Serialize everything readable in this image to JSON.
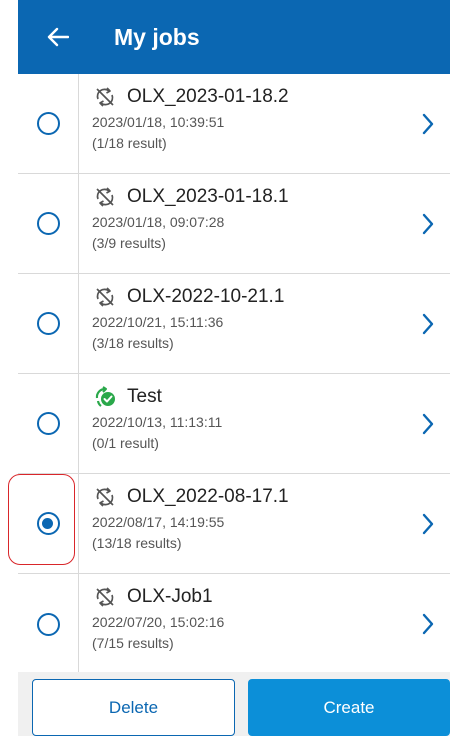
{
  "header": {
    "title": "My jobs",
    "back_icon": "arrow-left-icon",
    "color": "#0b67b2"
  },
  "jobs": [
    {
      "name": "OLX_2023-01-18.2",
      "date": "2023/01/18, 10:39:51",
      "results": "(1/18 result)",
      "icon": "sync-disabled-icon",
      "selected": false
    },
    {
      "name": "OLX_2023-01-18.1",
      "date": "2023/01/18, 09:07:28",
      "results": "(3/9 results)",
      "icon": "sync-disabled-icon",
      "selected": false
    },
    {
      "name": "OLX-2022-10-21.1",
      "date": "2022/10/21, 15:11:36",
      "results": "(3/18 results)",
      "icon": "sync-disabled-icon",
      "selected": false
    },
    {
      "name": "Test",
      "date": "2022/10/13, 11:13:11",
      "results": "(0/1 result)",
      "icon": "sync-ok-icon",
      "selected": false
    },
    {
      "name": "OLX_2022-08-17.1",
      "date": "2022/08/17, 14:19:55",
      "results": "(13/18 results)",
      "icon": "sync-disabled-icon",
      "selected": true
    },
    {
      "name": "OLX-Job1",
      "date": "2022/07/20, 15:02:16",
      "results": "(7/15 results)",
      "icon": "sync-disabled-icon",
      "selected": false
    }
  ],
  "footer": {
    "delete_label": "Delete",
    "create_label": "Create"
  },
  "colors": {
    "accent": "#0b67b2",
    "create_button": "#0c8fd8",
    "sync_ok": "#2aa84a",
    "highlight": "#d9262a"
  }
}
